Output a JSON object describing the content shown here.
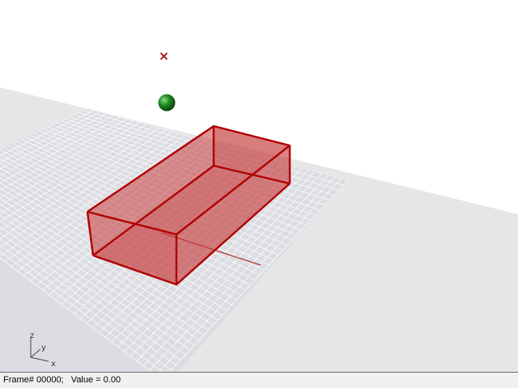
{
  "viewport": {
    "axis_labels": {
      "z": "z",
      "y": "y",
      "x": "x"
    },
    "colors": {
      "background": "#ffffff",
      "ground_plane": "#e6e6e6",
      "grid_fill": "#dcdde2",
      "grid_line": "#ffffff",
      "box_fill": "#c63b3b",
      "box_edge": "#b30000",
      "sphere": "#1f7a1f",
      "marker": "#b00000"
    },
    "objects": [
      {
        "name": "box",
        "type": "transparent-box",
        "selected": true
      },
      {
        "name": "sphere",
        "type": "sphere"
      },
      {
        "name": "point-marker",
        "type": "x-marker"
      }
    ]
  },
  "status_bar": {
    "frame_label": "Frame#",
    "frame_value": "00000;",
    "value_label": "Value =",
    "value": "0.00"
  }
}
